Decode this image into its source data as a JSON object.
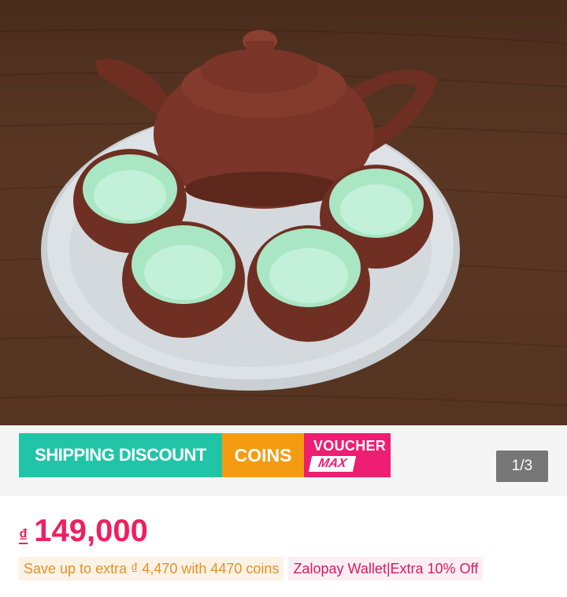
{
  "product_image": {
    "alt": "Teapot set with four cups on a white tray"
  },
  "promo_banner": {
    "shipping_label": "SHIPPING DISCOUNT",
    "coins_label": "COINS",
    "voucher_label": "VOUCHER",
    "voucher_max_label": "MAX",
    "colors": {
      "shipping": "#22c4a7",
      "coins": "#f39c12",
      "voucher": "#ee1e72"
    }
  },
  "gallery": {
    "counter": "1/3"
  },
  "price": {
    "currency": "₫",
    "value": "149,000",
    "color": "#ee2060"
  },
  "tags": {
    "coins_offer": "Save up to extra ₫ 4,470 with 4470 coins",
    "wallet_offer": "Zalopay Wallet|Extra 10% Off"
  }
}
